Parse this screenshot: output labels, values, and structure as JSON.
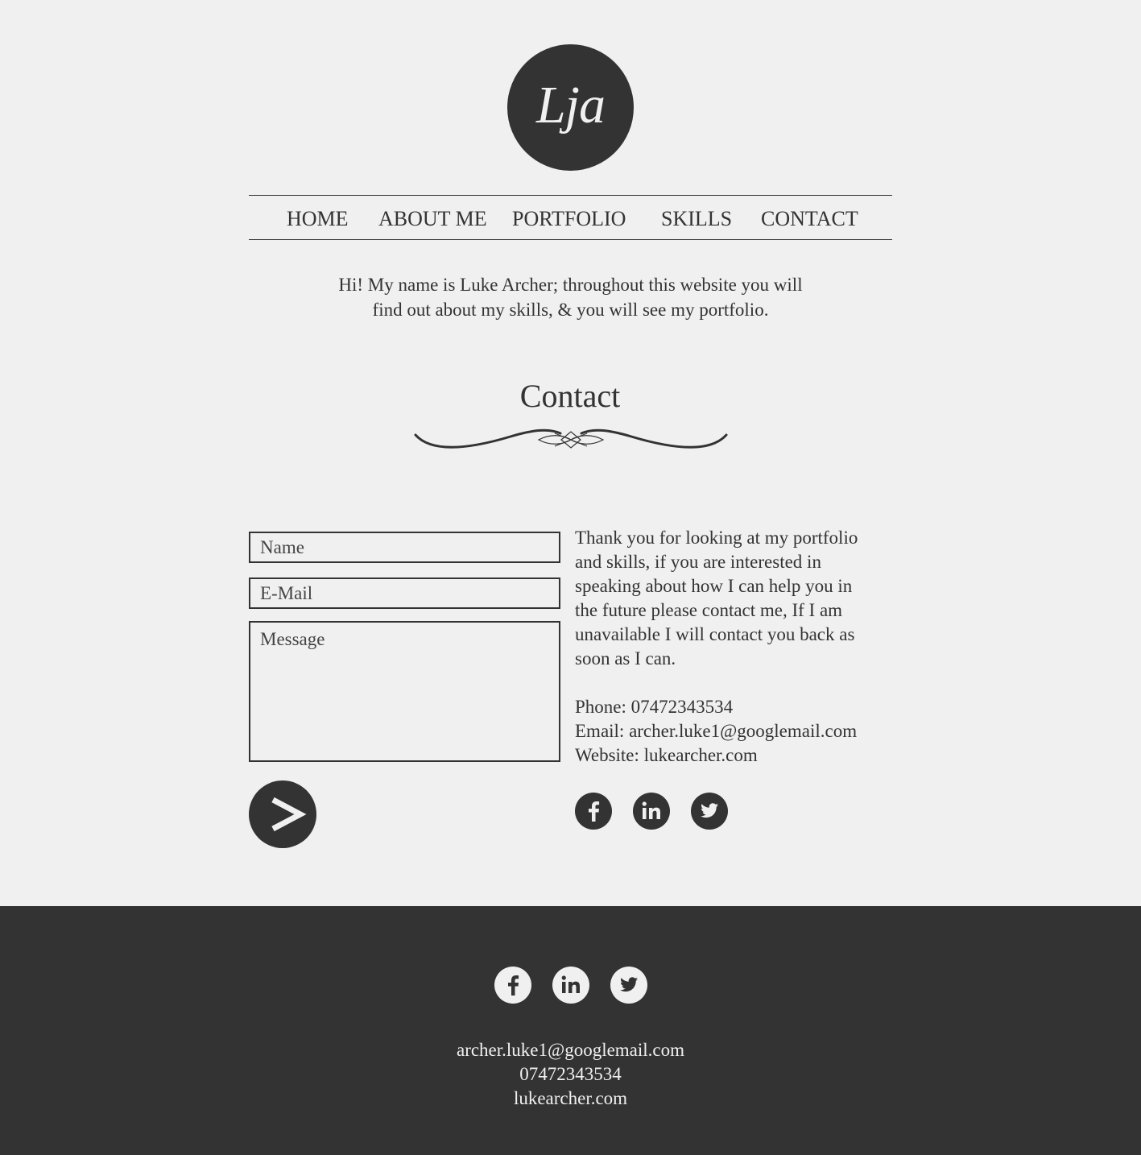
{
  "logo": {
    "text": "Lja"
  },
  "nav": {
    "items": [
      {
        "label": "HOME"
      },
      {
        "label": "ABOUT ME"
      },
      {
        "label": "PORTFOLIO"
      },
      {
        "label": "SKILLS"
      },
      {
        "label": "CONTACT"
      }
    ]
  },
  "intro": {
    "line1": "Hi! My name is Luke Archer; throughout this website you will",
    "line2": "find out about my skills, & you will see my portfolio."
  },
  "contact": {
    "title": "Contact",
    "form": {
      "name_placeholder": "Name",
      "email_placeholder": "E-Mail",
      "message_placeholder": "Message",
      "submit_icon": "arrow-right-icon"
    },
    "message_lines": [
      "Thank you for looking at my portfolio",
      "and skills, if you are interested in",
      "speaking about how I can help you in",
      "the future please contact me, If I am",
      "unavailable I will contact you back as",
      "soon as I can."
    ],
    "phone": "Phone: 07472343534",
    "email": "Email: archer.luke1@googlemail.com",
    "website": "Website: lukearcher.com"
  },
  "social": {
    "icons": [
      "facebook-icon",
      "linkedin-icon",
      "twitter-icon"
    ]
  },
  "footer": {
    "email": "archer.luke1@googlemail.com",
    "phone": "07472343534",
    "website": "lukearcher.com"
  },
  "colors": {
    "background": "#f0f0f0",
    "dark": "#333333"
  }
}
